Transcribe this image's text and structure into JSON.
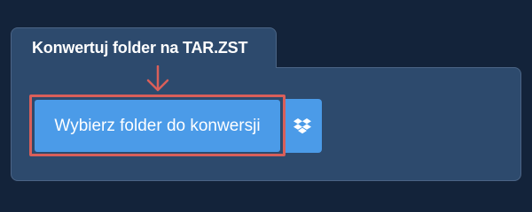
{
  "converter": {
    "tab_title": "Konwertuj folder na TAR.ZST",
    "choose_button_label": "Wybierz folder do konwersji",
    "dropbox_icon": "dropbox-icon",
    "hint_arrow_icon": "arrow-down-icon"
  },
  "colors": {
    "background": "#13233a",
    "panel": "#2d4a6d",
    "button": "#4b9be8",
    "highlight": "#d95f5a"
  }
}
